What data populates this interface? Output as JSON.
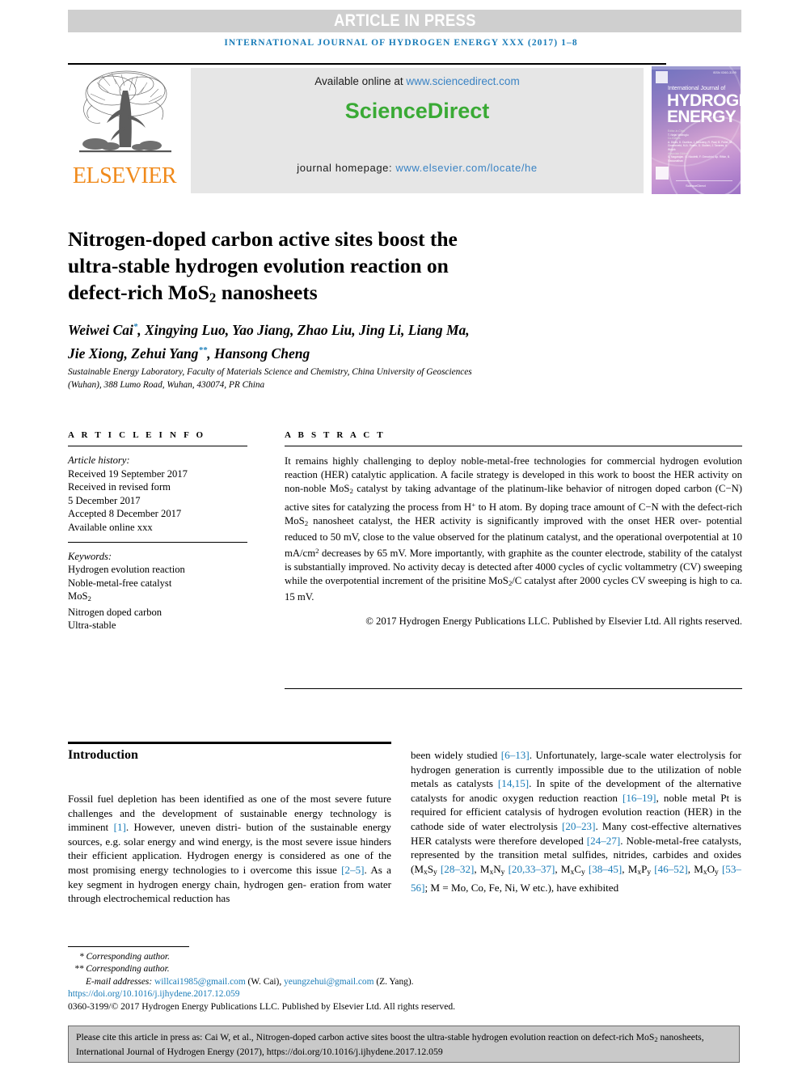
{
  "banner": {
    "text": "ARTICLE IN PRESS"
  },
  "running_head": {
    "text": "INTERNATIONAL JOURNAL OF HYDROGEN ENERGY XXX (2017) 1–8"
  },
  "masthead": {
    "publisher_logo_word": "ELSEVIER",
    "available_online_prefix": "Available online at ",
    "available_online_url": "www.sciencedirect.com",
    "sciencedirect_logo": "ScienceDirect",
    "homepage_prefix": "journal homepage: ",
    "homepage_url": "www.elsevier.com/locate/he"
  },
  "cover": {
    "issn": "ISSN 0360-3199",
    "line_ij": "International Journal of",
    "line_h": "HYDROGEN",
    "line_e": "ENERGY",
    "editors_label_1": "Editor-in-Chief",
    "editors_1": "T. Nejat Veziroglu",
    "editors_label_2": "Co-Editors",
    "editors_2": "A. Dicks, D. Dunikov, J. Nowotny,\nR. Paul, B. Pollet,\nM. Groeneveld, M.A. Rosen,\nD. Stolten, J. Tavares, A. Wojcik",
    "editors_label_3": "Associate Editors",
    "editors_3": "S. Nagarajan, G. Nicoletti,\nF. Orecchini, Ap. Rifkin,\nB. Viswanathan",
    "imprint": "ScienceDirect"
  },
  "article": {
    "title_lines": [
      "Nitrogen-doped carbon active sites boost the",
      "ultra-stable hydrogen evolution reaction on",
      "defect-rich MoS₂ nanosheets"
    ],
    "title_plain": "Nitrogen-doped carbon active sites boost the ultra-stable hydrogen evolution reaction on defect-rich MoS2 nanosheets",
    "authors_line_1": "Weiwei Cai*, Xingying Luo, Yao Jiang, Zhao Liu, Jing Li, Liang Ma,",
    "authors_line_2": "Jie Xiong, Zehui Yang**, Hansong Cheng",
    "affiliation_line_1": "Sustainable Energy Laboratory, Faculty of Materials Science and Chemistry, China University of Geosciences",
    "affiliation_line_2": "(Wuhan), 388 Lumo Road, Wuhan, 430074, PR China"
  },
  "article_info": {
    "heading": "A R T I C L E   I N F O",
    "history_label": "Article history:",
    "history": [
      "Received 19 September 2017",
      "Received in revised form",
      "5 December 2017",
      "Accepted 8 December 2017",
      "Available online xxx"
    ],
    "keywords_label": "Keywords:",
    "keywords": [
      "Hydrogen evolution reaction",
      "Noble-metal-free catalyst",
      "MoS2",
      "Nitrogen doped carbon",
      "Ultra-stable"
    ]
  },
  "abstract": {
    "heading": "A B S T R A C T",
    "body": "It remains highly challenging to deploy noble-metal-free technologies for commercial hydrogen evolution reaction (HER) catalytic application. A facile strategy is developed in this work to boost the HER activity on non-noble MoS2 catalyst by taking advantage of the platinum-like behavior of nitrogen doped carbon (C−N) active sites for catalyzing the process from H+ to H atom. By doping trace amount of C−N with the defect-rich MoS2 nanosheet catalyst, the HER activity is significantly improved with the onset HER overpotential reduced to 50 mV, close to the value observed for the platinum catalyst, and the operational overpotential at 10 mA/cm2 decreases by 65 mV. More importantly, with graphite as the counter electrode, stability of the catalyst is substantially improved. No activity decay is detected after 4000 cycles of cyclic voltammetry (CV) sweeping while the overpotential increment of the prisitine MoS2/C catalyst after 2000 cycles CV sweeping is high to ca. 15 mV.",
    "copyright": "© 2017 Hydrogen Energy Publications LLC. Published by Elsevier Ltd. All rights reserved."
  },
  "introduction": {
    "heading": "Introduction",
    "left_text": "Fossil fuel depletion has been identified as one of the most severe future challenges and the development of sustainable energy technology is imminent [1]. However, uneven distribution of the sustainable energy sources, e.g. solar energy and wind energy, is the most severe issue hinders their efficient application. Hydrogen energy is considered as one of the most promising energy technologies to i overcome this issue [2–5]. As a key segment in hydrogen energy chain, hydrogen generation from water through electrochemical reduction has",
    "right_text": "been widely studied [6–13]. Unfortunately, large-scale water electrolysis for hydrogen generation is currently impossible due to the utilization of noble metals as catalysts [14,15]. In spite of the development of the alternative catalysts for anodic oxygen reduction reaction [16–19], noble metal Pt is required for efficient catalysis of hydrogen evolution reaction (HER) in the cathode side of water electrolysis [20–23]. Many cost-effective alternatives HER catalysts were therefore developed [24–27]. Noble-metal-free catalysts, represented by the transition metal sulfides, nitrides, carbides and oxides (MxSy [28–32], MxNy [20,33–37], MxCy [38–45], MxPy [46–52], MxOy [53–56]; M = Mo, Co, Fe, Ni, W etc.), have exhibited"
  },
  "footnotes": {
    "corresponding_1": "* Corresponding author.",
    "corresponding_2": "** Corresponding author.",
    "email_label": "E-mail addresses:",
    "email_1": "willcai1985@gmail.com",
    "email_1_who": "(W. Cai),",
    "email_2": "yeungzehui@gmail.com",
    "email_2_who": "(Z. Yang).",
    "doi": "https://doi.org/10.1016/j.ijhydene.2017.12.059",
    "issn_line": "0360-3199/© 2017 Hydrogen Energy Publications LLC. Published by Elsevier Ltd. All rights reserved."
  },
  "citation_box": {
    "text": "Please cite this article in press as: Cai W, et al., Nitrogen-doped carbon active sites boost the ultra-stable hydrogen evolution reaction on defect-rich MoS2 nanosheets, International Journal of Hydrogen Energy (2017), https://doi.org/10.1016/j.ijhydene.2017.12.059"
  },
  "colors": {
    "accent_blue": "#1a7cb8",
    "link_blue": "#3a83c4",
    "sciencedirect_green": "#3aaa35",
    "elsevier_orange": "#f08a1b",
    "banner_grey": "#cfcfcf",
    "citebox_grey": "#c9c9c9"
  }
}
